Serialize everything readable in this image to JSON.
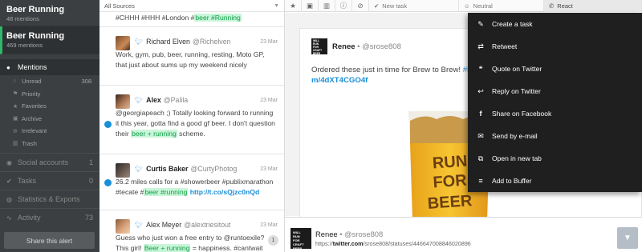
{
  "sidebar": {
    "alerts": [
      {
        "title": "Beer Running",
        "subtitle": "48 mentions"
      },
      {
        "title": "Beer Running",
        "subtitle": "469 mentions"
      }
    ],
    "mentions_label": "Mentions",
    "subitems": [
      {
        "label": "Unread",
        "count": "308",
        "icon": "circle-icon"
      },
      {
        "label": "Priority",
        "count": "",
        "icon": "flag-icon"
      },
      {
        "label": "Favorites",
        "count": "",
        "icon": "star-icon"
      },
      {
        "label": "Archive",
        "count": "",
        "icon": "archive-icon"
      },
      {
        "label": "Irrelevant",
        "count": "",
        "icon": "block-icon"
      },
      {
        "label": "Trash",
        "count": "",
        "icon": "trash-icon"
      }
    ],
    "sections": [
      {
        "label": "Social accounts",
        "count": "1",
        "icon": "users-icon"
      },
      {
        "label": "Tasks",
        "count": "0",
        "icon": "check-icon"
      },
      {
        "label": "Statistics & Exports",
        "count": "",
        "icon": "globe-icon"
      },
      {
        "label": "Activity",
        "count": "73",
        "icon": "activity-icon"
      }
    ],
    "share_button": "Share this alert"
  },
  "feed": {
    "sources_label": "All Sources",
    "top_partial": {
      "text": "#CHHH #HHH #London #",
      "hl": "beer #Running"
    },
    "items": [
      {
        "name": "Richard Elven",
        "handle": "@Richelven",
        "date": "23 Mar",
        "text": "Work, gym, pub, beer, running, resting, Moto GP, that just about sums up my weekend nicely"
      },
      {
        "name": "Alex",
        "handle": "@Palila",
        "date": "23 Mar",
        "t1": "@georgiapeach ;) Totally looking forward to running it this year, gotta find a good gf beer. I don't question their ",
        "hl": "beer + running",
        "t2": " scheme."
      },
      {
        "name": "Curtis Baker",
        "handle": "@CurtyPhotog",
        "date": "23 Mar",
        "t1": "26.2 miles calls for a #showerbeer #publixmarathon #tecate #",
        "hl": "beer #running",
        "link": "http://t.co/sQjzc0nQd"
      },
      {
        "name": "Alex Meyer",
        "handle": "@alextriesitout",
        "date": "23 Mar",
        "t1": "Guess who just won a free entry to @runtoexile? This girl! ",
        "hl": "Beer + running",
        "t2": " = happiness. #cantwait #runchat",
        "badge": "1"
      }
    ]
  },
  "toolbar": {
    "new_task": "New task",
    "sentiment": "Neutral",
    "react": "React"
  },
  "detail": {
    "name": "Renee",
    "handle": "@srose808",
    "body_1": "Ordered these just in time for Brew to Brew! ",
    "body_hash": "#be",
    "body_link": "m/4dXT4CGO4f",
    "logo_text": "WILL RUN FOR CRAFT BEER",
    "image_text": "RUN FOR BEER"
  },
  "menu": {
    "items": [
      {
        "label": "Create a task",
        "icon": "pencil-icon"
      },
      {
        "label": "Retweet",
        "icon": "retweet-icon"
      },
      {
        "label": "Quote on Twitter",
        "icon": "quote-icon"
      },
      {
        "label": "Reply on Twitter",
        "icon": "reply-icon"
      },
      {
        "label": "Share on Facebook",
        "icon": "facebook-icon"
      },
      {
        "label": "Send by e-mail",
        "icon": "mail-icon"
      },
      {
        "label": "Open in new tab",
        "icon": "new-tab-icon"
      },
      {
        "label": "Add to Buffer",
        "icon": "buffer-icon"
      }
    ]
  },
  "bottom": {
    "name": "Renee",
    "handle": "@srose808",
    "url_pre": "https://",
    "url_bold": "twitter.com",
    "url_post": "/srose808/statuses/446647008846020896"
  },
  "colors": {
    "accent": "#2fb86b",
    "link": "#1a8fd8",
    "highlight_bg": "#c9f5d9",
    "highlight_fg": "#12a04a",
    "sidebar": "#3c3f41",
    "menu": "#1f1f1f"
  }
}
